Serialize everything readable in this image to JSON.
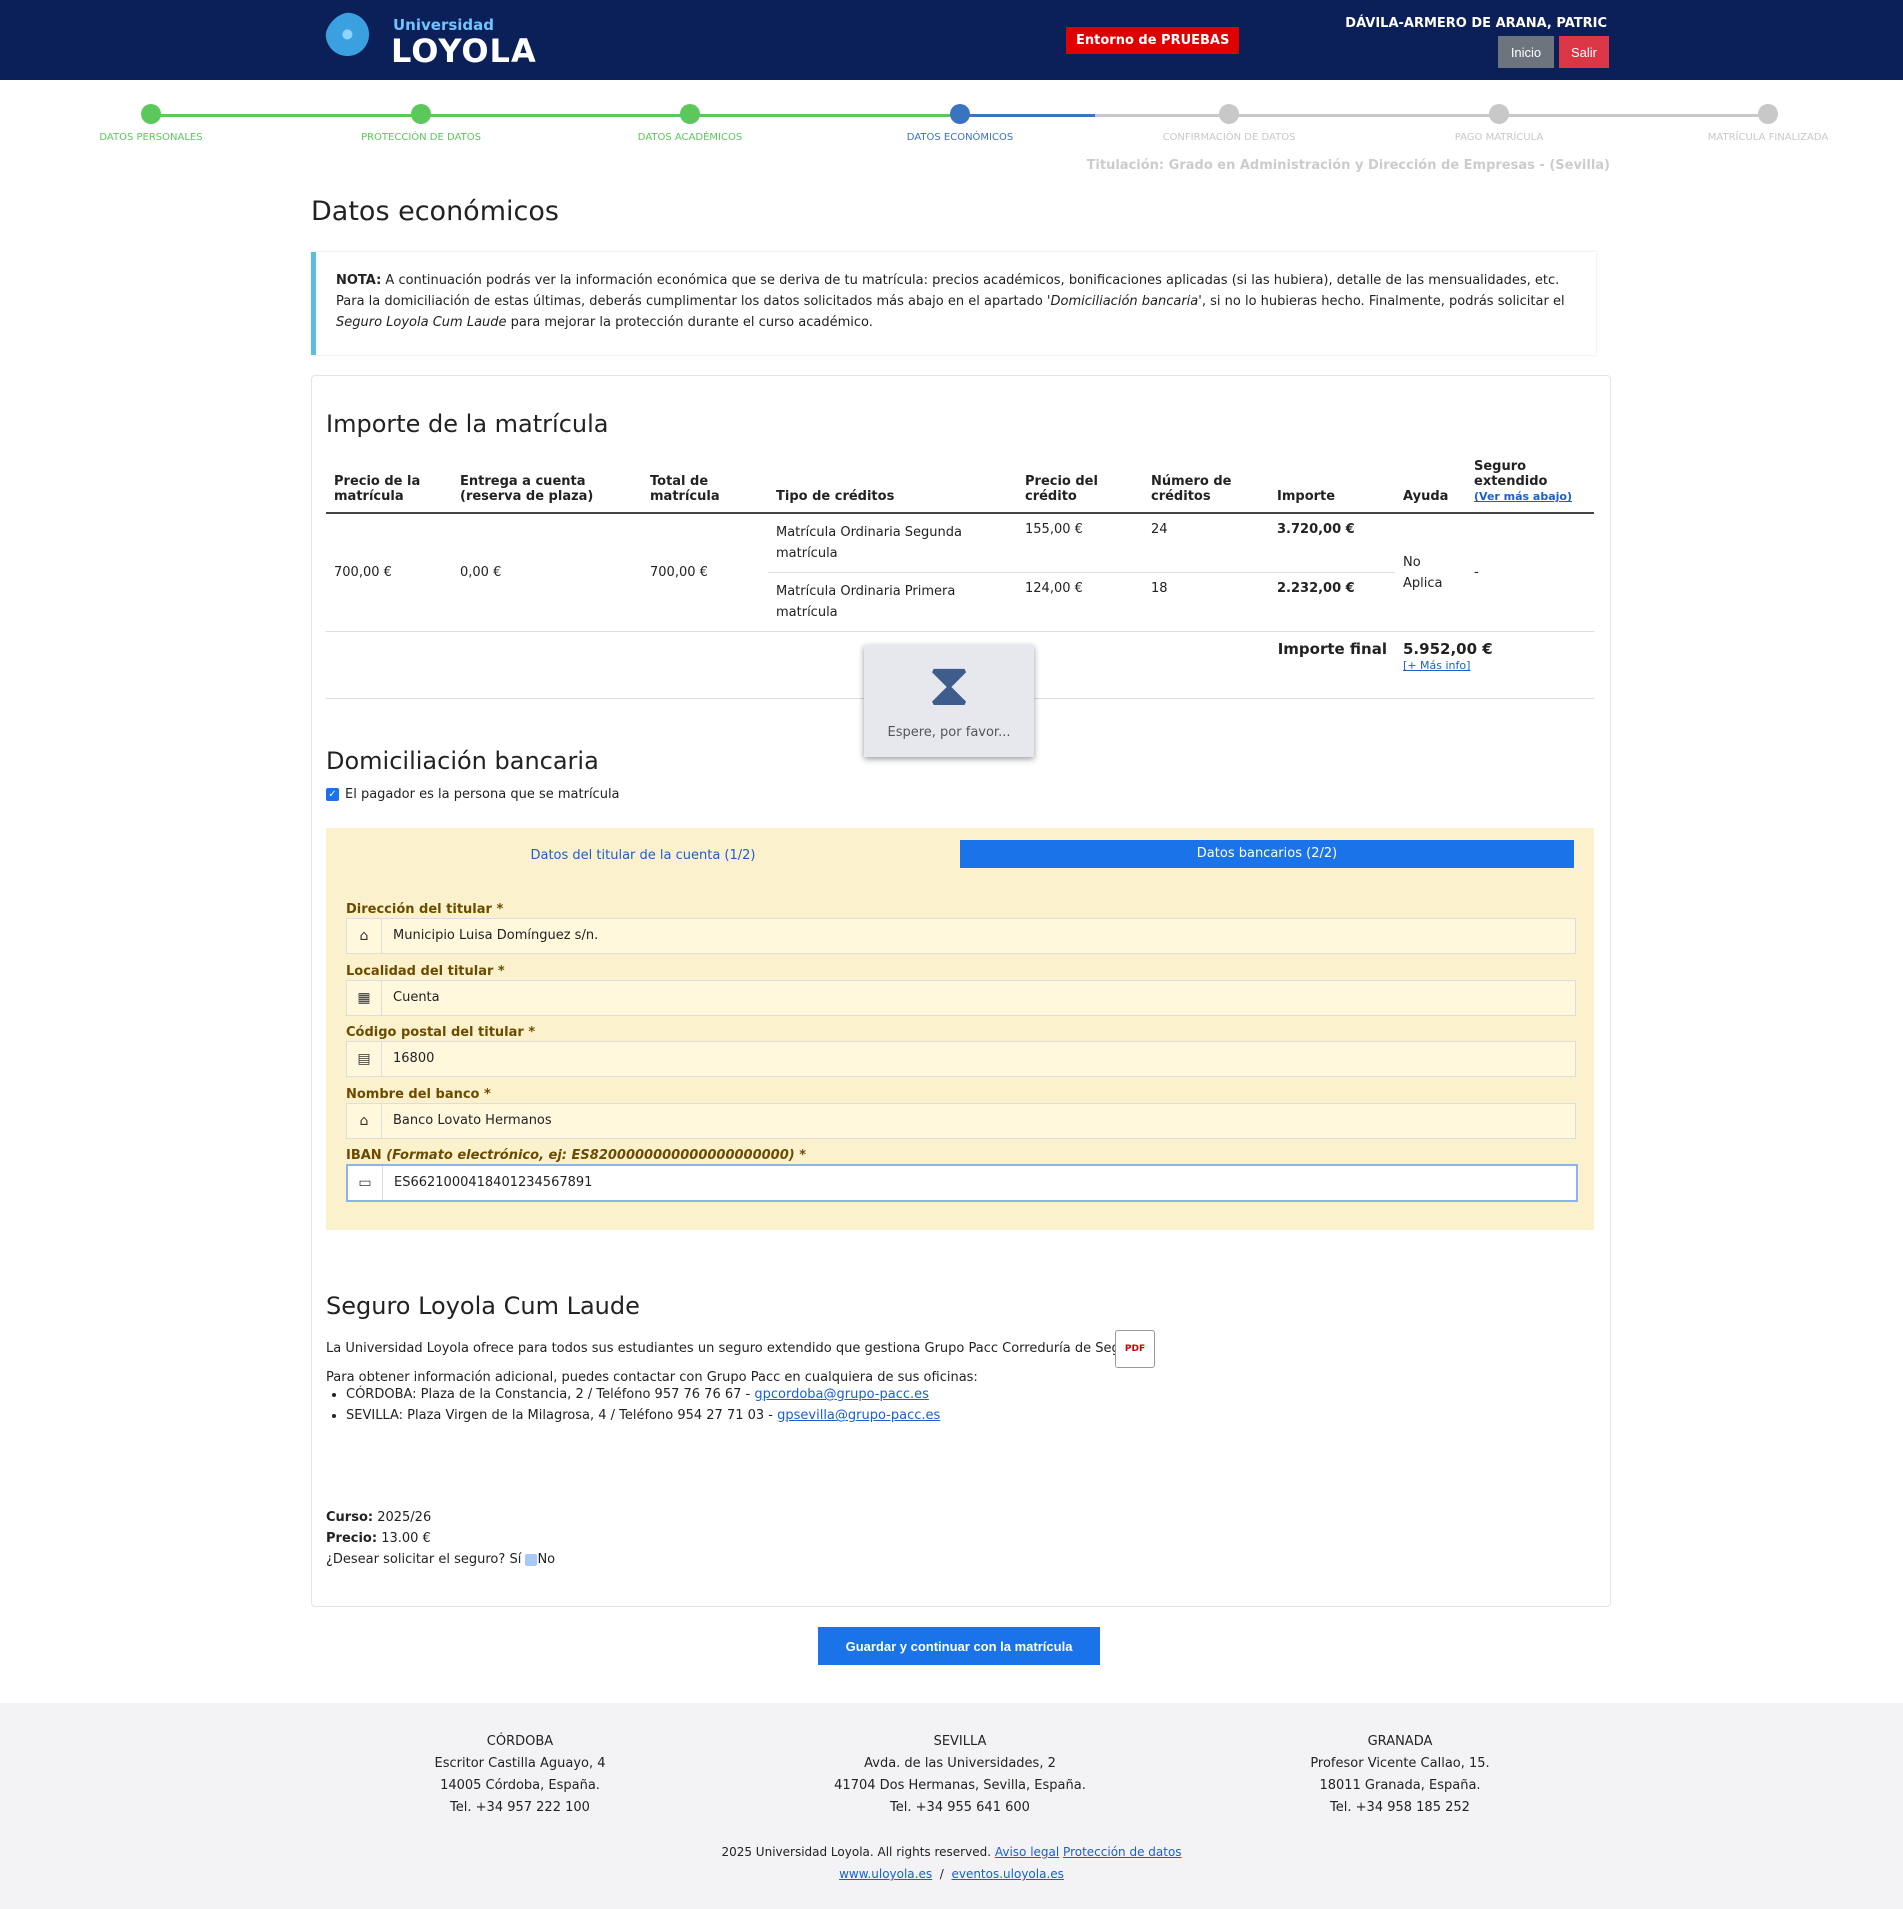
{
  "header": {
    "logo_small": "Universidad",
    "logo_big": "LOYOLA",
    "entorno": "Entorno de PRUEBAS",
    "user": "DÁVILA-ARMERO DE ARANA, PATRIC",
    "inicio": "Inicio",
    "salir": "Salir"
  },
  "steps": [
    {
      "label": "DATOS PERSONALES",
      "state": "done"
    },
    {
      "label": "PROTECCIÓN DE DATOS",
      "state": "done"
    },
    {
      "label": "DATOS ACADÉMICOS",
      "state": "done"
    },
    {
      "label": "DATOS ECONÓMICOS",
      "state": "current"
    },
    {
      "label": "CONFIRMACIÓN DE DATOS",
      "state": "pending"
    },
    {
      "label": "PAGO MATRÍCULA",
      "state": "pending"
    },
    {
      "label": "MATRÍCULA FINALIZADA",
      "state": "pending"
    }
  ],
  "colors": {
    "done": "#5cc85c",
    "current": "#3a73bf",
    "pending": "#c8c8c8",
    "navy": "#0b2058"
  },
  "titulacion": "Titulación: Grado en Administración y Dirección de Empresas - (Sevilla)",
  "page_title": "Datos económicos",
  "nota": {
    "label": "NOTA:",
    "text1": " A continuación podrás ver la información económica que se deriva de tu matrícula: precios académicos, bonificaciones aplicadas (si las hubiera), detalle de las mensualidades, etc. Para la domiciliación de estas últimas, deberás cumplimentar los datos solicitados más abajo en el apartado ",
    "em1": "'Domiciliación bancaria'",
    "text2": ", si no lo hubieras hecho. Finalmente, podrás solicitar el ",
    "em2": "Seguro Loyola Cum Laude",
    "text3": " para mejorar la protección durante el curso académico."
  },
  "importe": {
    "title": "Importe de la matrícula",
    "headers": [
      "Precio de la matrícula",
      "Entrega a cuenta (reserva de plaza)",
      "Total de matrícula",
      "Tipo de créditos",
      "Precio del crédito",
      "Número de créditos",
      "Importe",
      "Ayuda",
      "Seguro extendido"
    ],
    "ver_mas": "(Ver más abajo)",
    "precio": "700,00 €",
    "entrega": "0,00 €",
    "total": "700,00 €",
    "rows": [
      {
        "tipo": "Matrícula Ordinaria Segunda matrícula",
        "precio": "155,00 €",
        "num": "24",
        "importe": "3.720,00 €"
      },
      {
        "tipo": "Matrícula Ordinaria Primera matrícula",
        "precio": "124,00 €",
        "num": "18",
        "importe": "2.232,00 €"
      }
    ],
    "ayuda": "No Aplica",
    "seguro": "-",
    "final_label": "Importe final",
    "final_value": "5.952,00 €",
    "mas_info": "[+ Más info]"
  },
  "loading": {
    "text": "Espere, por favor..."
  },
  "domiciliacion": {
    "title": "Domiciliación bancaria",
    "checkbox": "El pagador es la persona que se matrícula",
    "tab1": "Datos del titular de la cuenta (1/2)",
    "tab2": "Datos bancarios (2/2)",
    "direccion_label": "Dirección del titular *",
    "direccion": "Municipio Luisa Domínguez s/n.",
    "localidad_label": "Localidad del titular *",
    "localidad": "Cuenta",
    "cp_label": "Código postal del titular *",
    "cp": "16800",
    "banco_label": "Nombre del banco *",
    "banco": "Banco Lovato Hermanos",
    "iban_label": "IBAN",
    "iban_hint": "(Formato electrónico, ej: ES8200000000000000000000) *",
    "iban": "ES6621000418401234567891"
  },
  "seguro": {
    "title": "Seguro Loyola Cum Laude",
    "intro": "La Universidad Loyola ofrece para todos sus estudiantes un seguro extendido que gestiona Grupo Pacc Correduría de Seguros.",
    "pdf": "PDF",
    "contact": "Para obtener información adicional, puedes contactar con Grupo Pacc en cualquiera de sus oficinas:",
    "cordoba": "CÓRDOBA: Plaza de la Constancia, 2 / Teléfono 957 76 76 67 - ",
    "cordoba_mail": "gpcordoba@grupo-pacc.es",
    "sevilla": "SEVILLA: Plaza Virgen de la Milagrosa, 4 / Teléfono 954 27 71 03 - ",
    "sevilla_mail": "gpsevilla@grupo-pacc.es",
    "curso_label": "Curso:",
    "curso": "2025/26",
    "precio_label": "Precio:",
    "precio": "13.00 €",
    "pregunta": "¿Desear solicitar el seguro?",
    "si": "Sí",
    "no": "No"
  },
  "save_button": "Guardar y continuar con la matrícula",
  "footer": {
    "offices": [
      {
        "city": "CÓRDOBA",
        "line1": "Escritor Castilla Aguayo, 4",
        "line2": "14005 Córdoba, España.",
        "tel": "Tel. +34 957 222 100"
      },
      {
        "city": "SEVILLA",
        "line1": "Avda. de las Universidades, 2",
        "line2": "41704 Dos Hermanas, Sevilla, España.",
        "tel": "Tel. +34 955 641 600"
      },
      {
        "city": "GRANADA",
        "line1": "Profesor Vicente Callao, 15.",
        "line2": "18011 Granada, España.",
        "tel": "Tel. +34 958 185 252"
      }
    ],
    "copyright": "2025 Universidad Loyola. All rights reserved.",
    "aviso": "Aviso legal",
    "proteccion": "Protección de datos",
    "web": "www.uloyola.es",
    "sep": "/",
    "eventos": "eventos.uloyola.es"
  }
}
